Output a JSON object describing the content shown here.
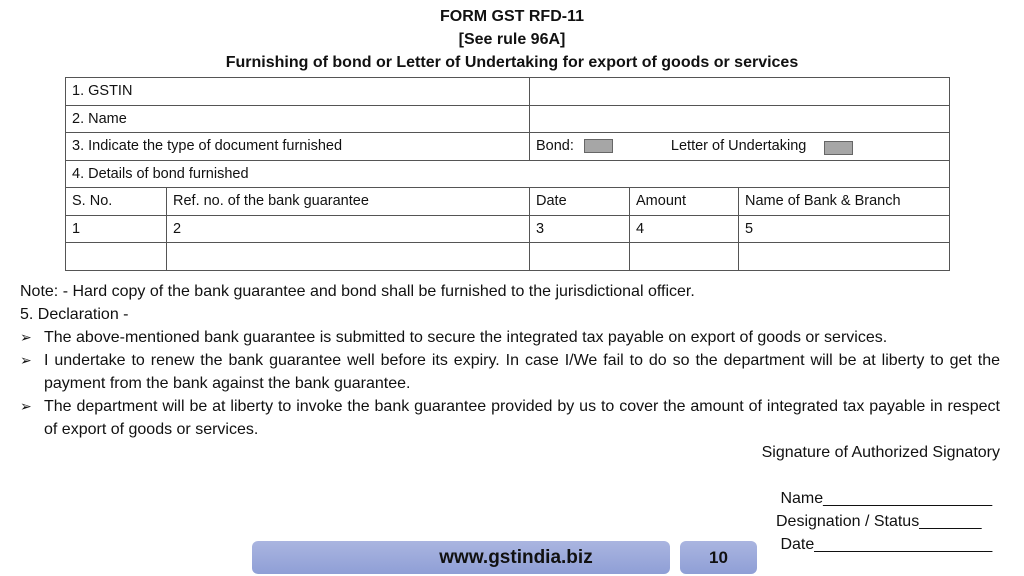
{
  "header": {
    "form_title": "FORM GST RFD-11",
    "rule": "[See rule 96A]",
    "subtitle": "Furnishing of bond or Letter of Undertaking for export of goods or services"
  },
  "form_table": {
    "gstin_label": "1.  GSTIN",
    "gstin_value": "",
    "name_label": "2. Name",
    "name_value": "",
    "doc_type_label": "3. Indicate the type of document furnished",
    "bond_label": "Bond:",
    "lou_label": "Letter of Undertaking",
    "bond_details_label": "4. Details of bond furnished",
    "columns": [
      "S. No.",
      "Ref. no. of the bank guarantee",
      "Date",
      "Amount",
      "Name of Bank & Branch"
    ],
    "numbering_row": [
      "1",
      "2",
      "3",
      "4",
      "5"
    ],
    "empty_row": [
      "",
      "",
      "",
      "",
      ""
    ]
  },
  "note": "Note: - Hard copy of the bank guarantee and bond shall be furnished to the jurisdictional officer.",
  "declaration": {
    "heading": "5. Declaration -",
    "bullet_icon": "arrow-bullet-icon",
    "items": [
      "The above-mentioned bank guarantee is submitted to secure the integrated tax payable on export of goods or services.",
      "I undertake to renew the bank guarantee well before its expiry. In case I/We fail to do so the department will be at liberty to get the payment from the bank against the bank guarantee.",
      "The department will be at liberty to invoke the bank guarantee provided by us to cover the amount of integrated tax payable in respect of export of goods or services."
    ]
  },
  "signature": {
    "label": "Signature of Authorized Signatory",
    "name_field": " Name___________________",
    "designation_field": "Designation / Status_______",
    "date_field": " Date____________________"
  },
  "footer": {
    "website": "www.gstindia.biz",
    "page_number": "10",
    "bar_color": "#9aa8dc"
  }
}
